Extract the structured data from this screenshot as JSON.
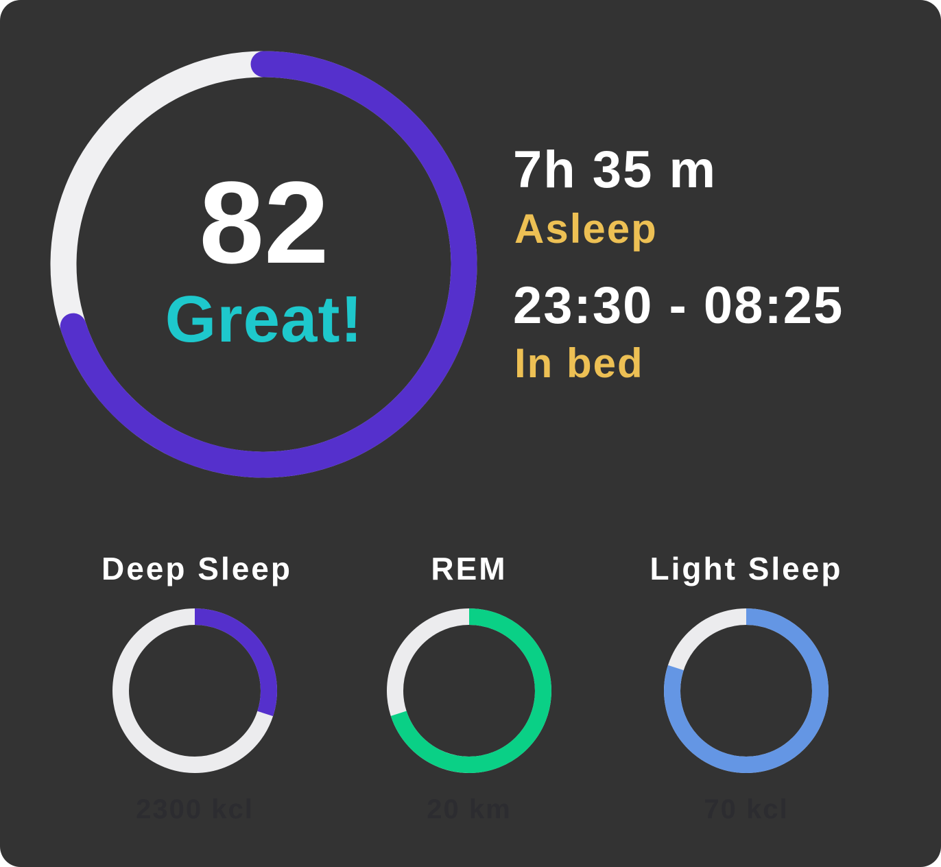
{
  "summary": {
    "score": "82",
    "score_fraction": 0.7,
    "rating": "Great!",
    "duration": "7h 35 m",
    "duration_label": "Asleep",
    "time_range": "23:30 - 08:25",
    "time_range_label": "In bed"
  },
  "stages": [
    {
      "title": "Deep Sleep",
      "fraction": 0.3,
      "subtitle": "2300 kcl"
    },
    {
      "title": "REM",
      "fraction": 0.7,
      "subtitle": "20 km"
    },
    {
      "title": "Light Sleep",
      "fraction": 0.8,
      "subtitle": "70 kcl"
    }
  ],
  "colors": {
    "card_bg": "#333333",
    "track": "#ececee",
    "score_arc": "#5530cc",
    "rating_text": "#1ec8cc",
    "label_text": "#edc054",
    "deep_sleep": "#5530cc",
    "rem": "#0ad086",
    "light_sleep": "#6496e4"
  }
}
